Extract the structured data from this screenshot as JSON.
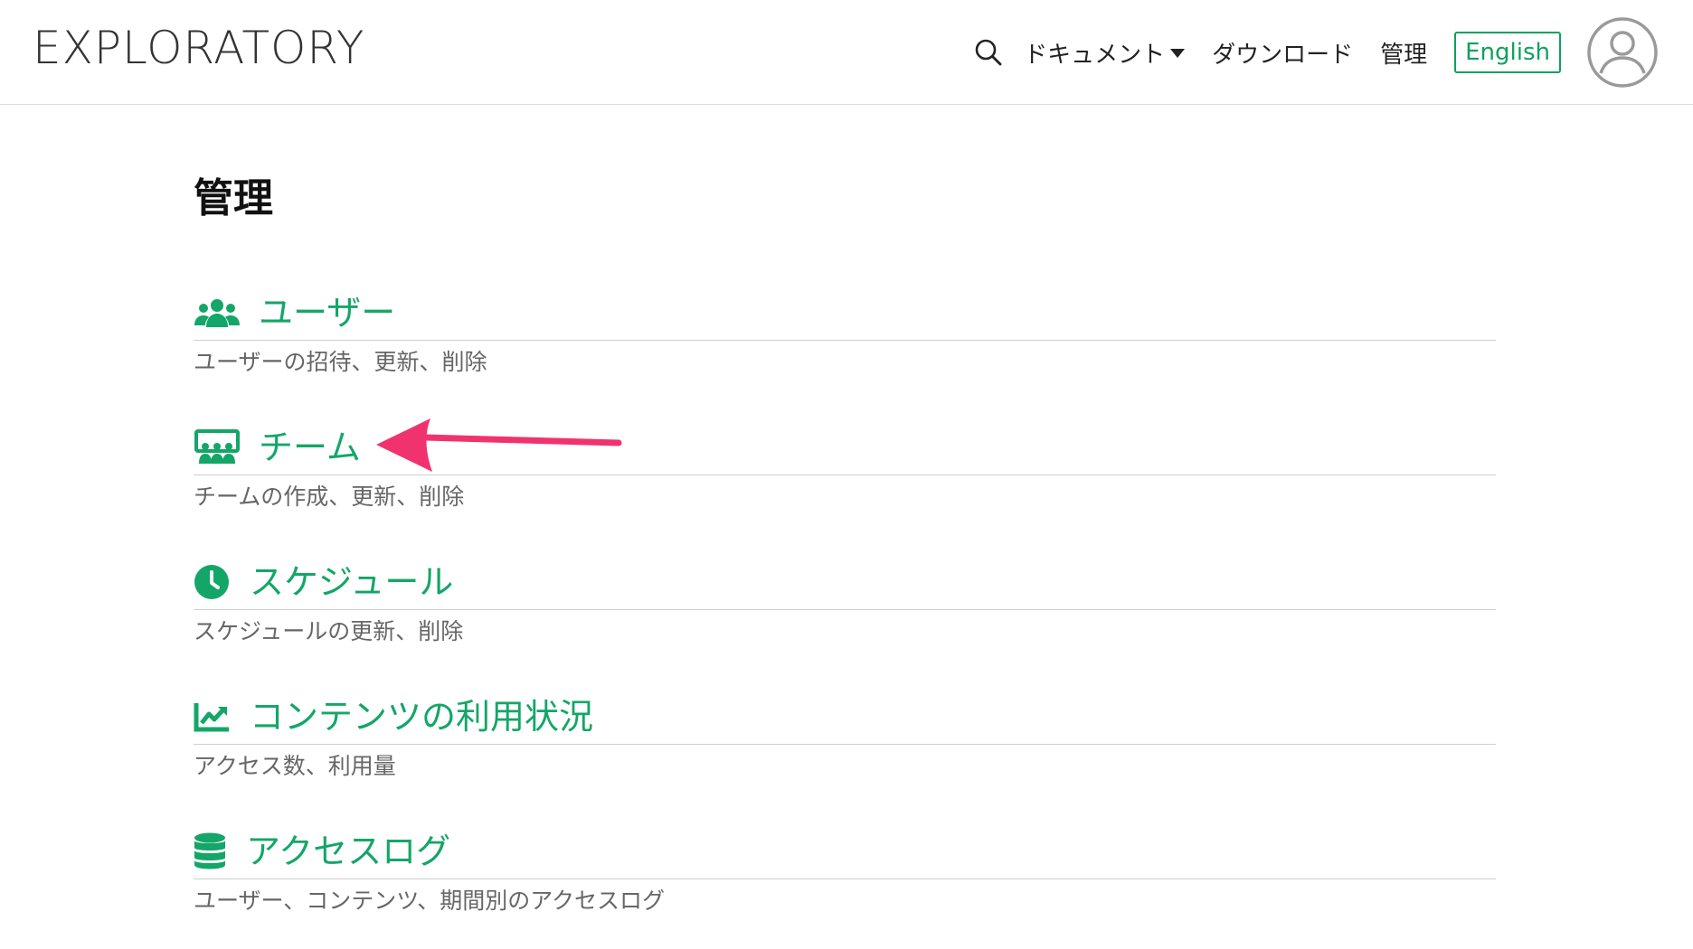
{
  "header": {
    "logo": "EXPLORATORY",
    "nav": {
      "documents": "ドキュメント",
      "download": "ダウンロード",
      "admin": "管理",
      "language": "English"
    }
  },
  "main": {
    "title": "管理",
    "sections": [
      {
        "title": "ユーザー",
        "description": "ユーザーの招待、更新、削除",
        "icon": "users-icon"
      },
      {
        "title": "チーム",
        "description": "チームの作成、更新、削除",
        "icon": "team-icon"
      },
      {
        "title": "スケジュール",
        "description": "スケジュールの更新、削除",
        "icon": "clock-icon"
      },
      {
        "title": "コンテンツの利用状況",
        "description": "アクセス数、利用量",
        "icon": "chart-line-icon"
      },
      {
        "title": "アクセスログ",
        "description": "ユーザー、コンテンツ、期間別のアクセスログ",
        "icon": "database-icon"
      }
    ]
  },
  "colors": {
    "accent": "#14a668",
    "annotation_arrow": "#f0336e"
  }
}
